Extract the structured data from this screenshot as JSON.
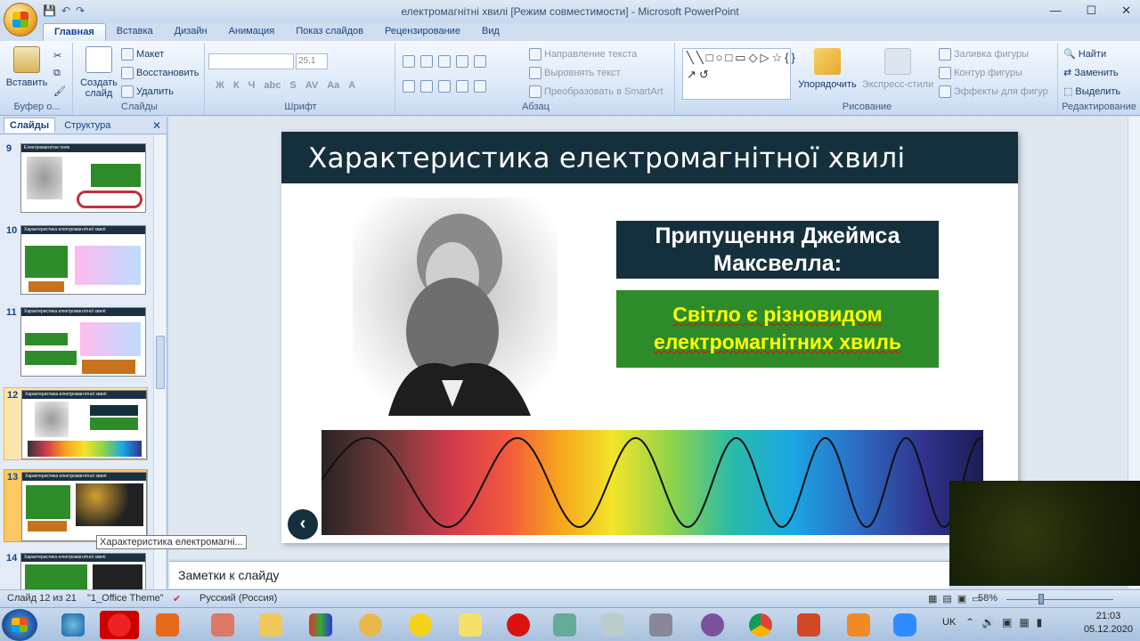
{
  "window": {
    "title": "електромагнітні хвилі [Режим совместимости] - Microsoft PowerPoint",
    "controls": [
      "—",
      "☐",
      "✕"
    ]
  },
  "ribbon_tabs": [
    "Главная",
    "Вставка",
    "Дизайн",
    "Анимация",
    "Показ слайдов",
    "Рецензирование",
    "Вид"
  ],
  "ribbon": {
    "clipboard": {
      "paste": "Вставить",
      "label": "Буфер о..."
    },
    "slides": {
      "create": "Создать слайд",
      "layout": "Макет",
      "reset": "Восстановить",
      "delete": "Удалить",
      "label": "Слайды"
    },
    "font": {
      "size": "25,1",
      "label": "Шрифт",
      "buttons": [
        "Ж",
        "К",
        "Ч",
        "abc",
        "S",
        "AV",
        "Aa",
        "A"
      ]
    },
    "paragraph": {
      "direction": "Направление текста",
      "align": "Выровнять текст",
      "smartart": "Преобразовать в SmartArt",
      "label": "Абзац"
    },
    "drawing": {
      "arrange": "Упорядочить",
      "styles": "Экспресс-стили",
      "fill": "Заливка фигуры",
      "outline": "Контур фигуры",
      "effects": "Эффекты для фигур",
      "label": "Рисование"
    },
    "editing": {
      "find": "Найти",
      "replace": "Заменить",
      "select": "Выделить",
      "label": "Редактирование"
    }
  },
  "pane": {
    "tabs": [
      "Слайды",
      "Структура"
    ],
    "close": "✕",
    "thumbnails": [
      {
        "num": "9",
        "title": "Електромагнітне поле"
      },
      {
        "num": "10",
        "title": "Характеристика електромагнітної хвилі"
      },
      {
        "num": "11",
        "title": "Характеристика електромагнітної хвилі"
      },
      {
        "num": "12",
        "title": "Характеристика електромагнітної хвилі"
      },
      {
        "num": "13",
        "title": "Характеристика електромагнітної хвилі"
      },
      {
        "num": "14",
        "title": "Характеристика електромагнітної хвилі"
      }
    ],
    "tooltip": "Характеристика електромагні..."
  },
  "slide": {
    "title": "Характеристика електромагнітної хвилі",
    "box1": "Припущення Джеймса Максвелла:",
    "box2": "Світло є різновидом електромагнітних хвиль",
    "nav": "‹"
  },
  "notes": {
    "placeholder": "Заметки к слайду"
  },
  "status": {
    "slide": "Слайд 12 из 21",
    "theme": "\"1_Office Theme\"",
    "lang": "Русский (Россия)",
    "zoom": "58%"
  },
  "tray": {
    "lang": "UK",
    "time": "21:03",
    "date": "05.12.2020"
  },
  "colors": {
    "slide_header": "#15303d",
    "green_box": "#2e8b2a",
    "highlight_text": "#ffff00"
  }
}
